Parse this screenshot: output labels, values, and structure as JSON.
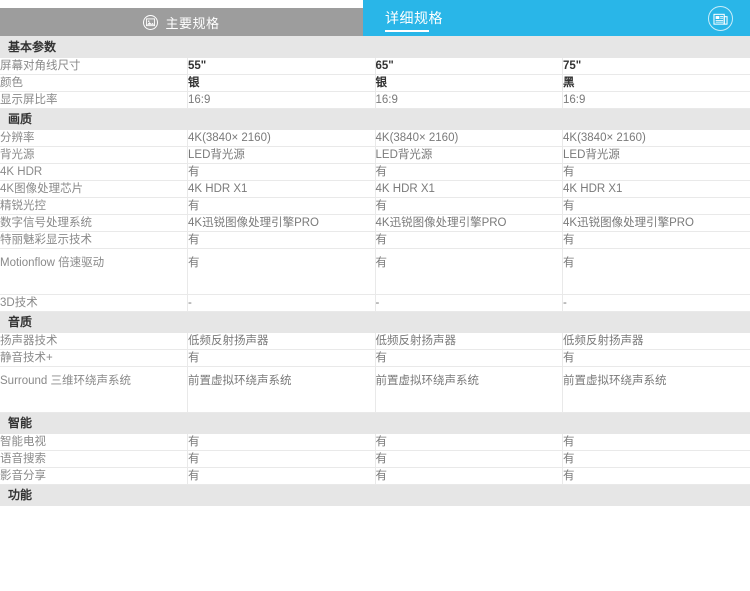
{
  "tabs": [
    {
      "label": "主要规格",
      "active": false,
      "icon": "picture-icon"
    },
    {
      "label": "详细规格",
      "active": true,
      "icon": null
    }
  ],
  "header": {
    "doc_icon": "newspaper-icon",
    "active_color": "#29b6e8",
    "inactive_color": "#9d9d9d"
  },
  "table": {
    "columns": [
      "",
      "55\"",
      "65\"",
      "75\""
    ],
    "sections": [
      {
        "title": "基本参数",
        "rows": [
          {
            "label": "屏幕对角线尺寸",
            "values": [
              "55\"",
              "65\"",
              "75\""
            ],
            "bold": true
          },
          {
            "label": "颜色",
            "values": [
              "银",
              "银",
              "黑"
            ],
            "bold": true
          },
          {
            "label": "显示屏比率",
            "values": [
              "16:9",
              "16:9",
              "16:9"
            ],
            "bold": false
          }
        ]
      },
      {
        "title": "画质",
        "rows": [
          {
            "label": "分辨率",
            "values": [
              "4K(3840× 2160)",
              "4K(3840× 2160)",
              "4K(3840× 2160)"
            ],
            "bold": false
          },
          {
            "label": "背光源",
            "values": [
              "LED背光源",
              "LED背光源",
              "LED背光源"
            ],
            "bold": false
          },
          {
            "label": "4K HDR",
            "values": [
              "有",
              "有",
              "有"
            ],
            "bold": false
          },
          {
            "label": "4K图像处理芯片",
            "values": [
              "4K HDR X1",
              "4K HDR X1",
              "4K HDR X1"
            ],
            "bold": false
          },
          {
            "label": "精锐光控",
            "values": [
              "有",
              "有",
              "有"
            ],
            "bold": false
          },
          {
            "label": "数字信号处理系统",
            "values": [
              "4K迅锐图像处理引擎PRO",
              "4K迅锐图像处理引擎PRO",
              "4K迅锐图像处理引擎PRO"
            ],
            "bold": false
          },
          {
            "label": "特丽魅彩显示技术",
            "values": [
              "有",
              "有",
              "有"
            ],
            "bold": false
          },
          {
            "label": "Motionflow 倍速驱动",
            "values": [
              "有",
              "有",
              "有"
            ],
            "bold": false,
            "tall": true
          },
          {
            "label": "3D技术",
            "values": [
              "-",
              "-",
              "-"
            ],
            "bold": false
          }
        ]
      },
      {
        "title": "音质",
        "rows": [
          {
            "label": "扬声器技术",
            "values": [
              "低频反射扬声器",
              "低频反射扬声器",
              "低频反射扬声器"
            ],
            "bold": false
          },
          {
            "label": "静音技术+",
            "values": [
              "有",
              "有",
              "有"
            ],
            "bold": false
          },
          {
            "label": "Surround 三维环绕声系统",
            "values": [
              "前置虚拟环绕声系统",
              "前置虚拟环绕声系统",
              "前置虚拟环绕声系统"
            ],
            "bold": false,
            "tall": true
          }
        ]
      },
      {
        "title": "智能",
        "rows": [
          {
            "label": "智能电视",
            "values": [
              "有",
              "有",
              "有"
            ],
            "bold": false
          },
          {
            "label": "语音搜索",
            "values": [
              "有",
              "有",
              "有"
            ],
            "bold": false
          },
          {
            "label": "影音分享",
            "values": [
              "有",
              "有",
              "有"
            ],
            "bold": false
          }
        ]
      },
      {
        "title": "功能",
        "rows": []
      }
    ]
  }
}
